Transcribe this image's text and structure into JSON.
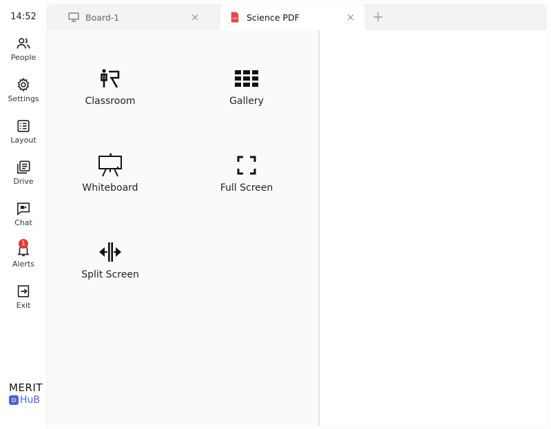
{
  "sidebar": {
    "time": "14:52",
    "items": [
      {
        "label": "People"
      },
      {
        "label": "Settings"
      },
      {
        "label": "Layout"
      },
      {
        "label": "Drive"
      },
      {
        "label": "Chat"
      },
      {
        "label": "Alerts",
        "badge": "1"
      },
      {
        "label": "Exit"
      }
    ],
    "brand": {
      "top": "MERIT",
      "bottom": "HuB"
    }
  },
  "tabs": [
    {
      "label": "Board-1",
      "icon": "presentation-board-icon",
      "active": false
    },
    {
      "label": "Science PDF",
      "icon": "pdf-file-icon",
      "active": true
    }
  ],
  "add_tab_label": "+",
  "close_label": "×",
  "layout_options": [
    {
      "label": "Classroom",
      "icon": "classroom-icon"
    },
    {
      "label": "Gallery",
      "icon": "gallery-grid-icon"
    },
    {
      "label": "Whiteboard",
      "icon": "whiteboard-easel-icon"
    },
    {
      "label": "Full Screen",
      "icon": "fullscreen-icon"
    },
    {
      "label": "Split Screen",
      "icon": "split-screen-icon"
    }
  ],
  "colors": {
    "accent": "#4d63d8",
    "badge": "#e53935",
    "pdf": "#e5484d"
  }
}
